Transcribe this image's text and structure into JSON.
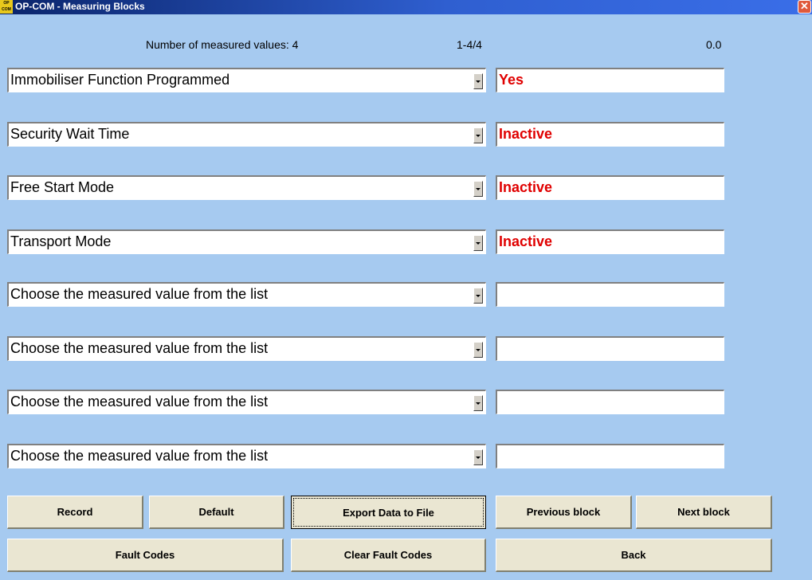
{
  "window": {
    "title": "OP-COM - Measuring Blocks",
    "icon": "OP COM"
  },
  "header": {
    "count_label": "Number of measured values: 4",
    "range": "1-4/4",
    "time": "0.0"
  },
  "rows": [
    {
      "label": "Immobiliser Function Programmed",
      "value": "Yes"
    },
    {
      "label": "Security Wait Time",
      "value": "Inactive"
    },
    {
      "label": "Free Start Mode",
      "value": "Inactive"
    },
    {
      "label": "Transport Mode",
      "value": "Inactive"
    },
    {
      "label": "Choose the measured value from the list",
      "value": ""
    },
    {
      "label": "Choose the measured value from the list",
      "value": ""
    },
    {
      "label": "Choose the measured value from the list",
      "value": ""
    },
    {
      "label": "Choose the measured value from the list",
      "value": ""
    }
  ],
  "buttons": {
    "record": "Record",
    "default": "Default",
    "export": "Export Data to File",
    "previous": "Previous block",
    "next": "Next block",
    "fault_codes": "Fault Codes",
    "clear_fault_codes": "Clear Fault Codes",
    "back": "Back"
  },
  "colors": {
    "background": "#a6caf0",
    "value_text": "#e00000",
    "button_face": "#eae6d2"
  },
  "icons": {
    "close": "close-icon",
    "dropdown": "chevron-down-icon"
  }
}
